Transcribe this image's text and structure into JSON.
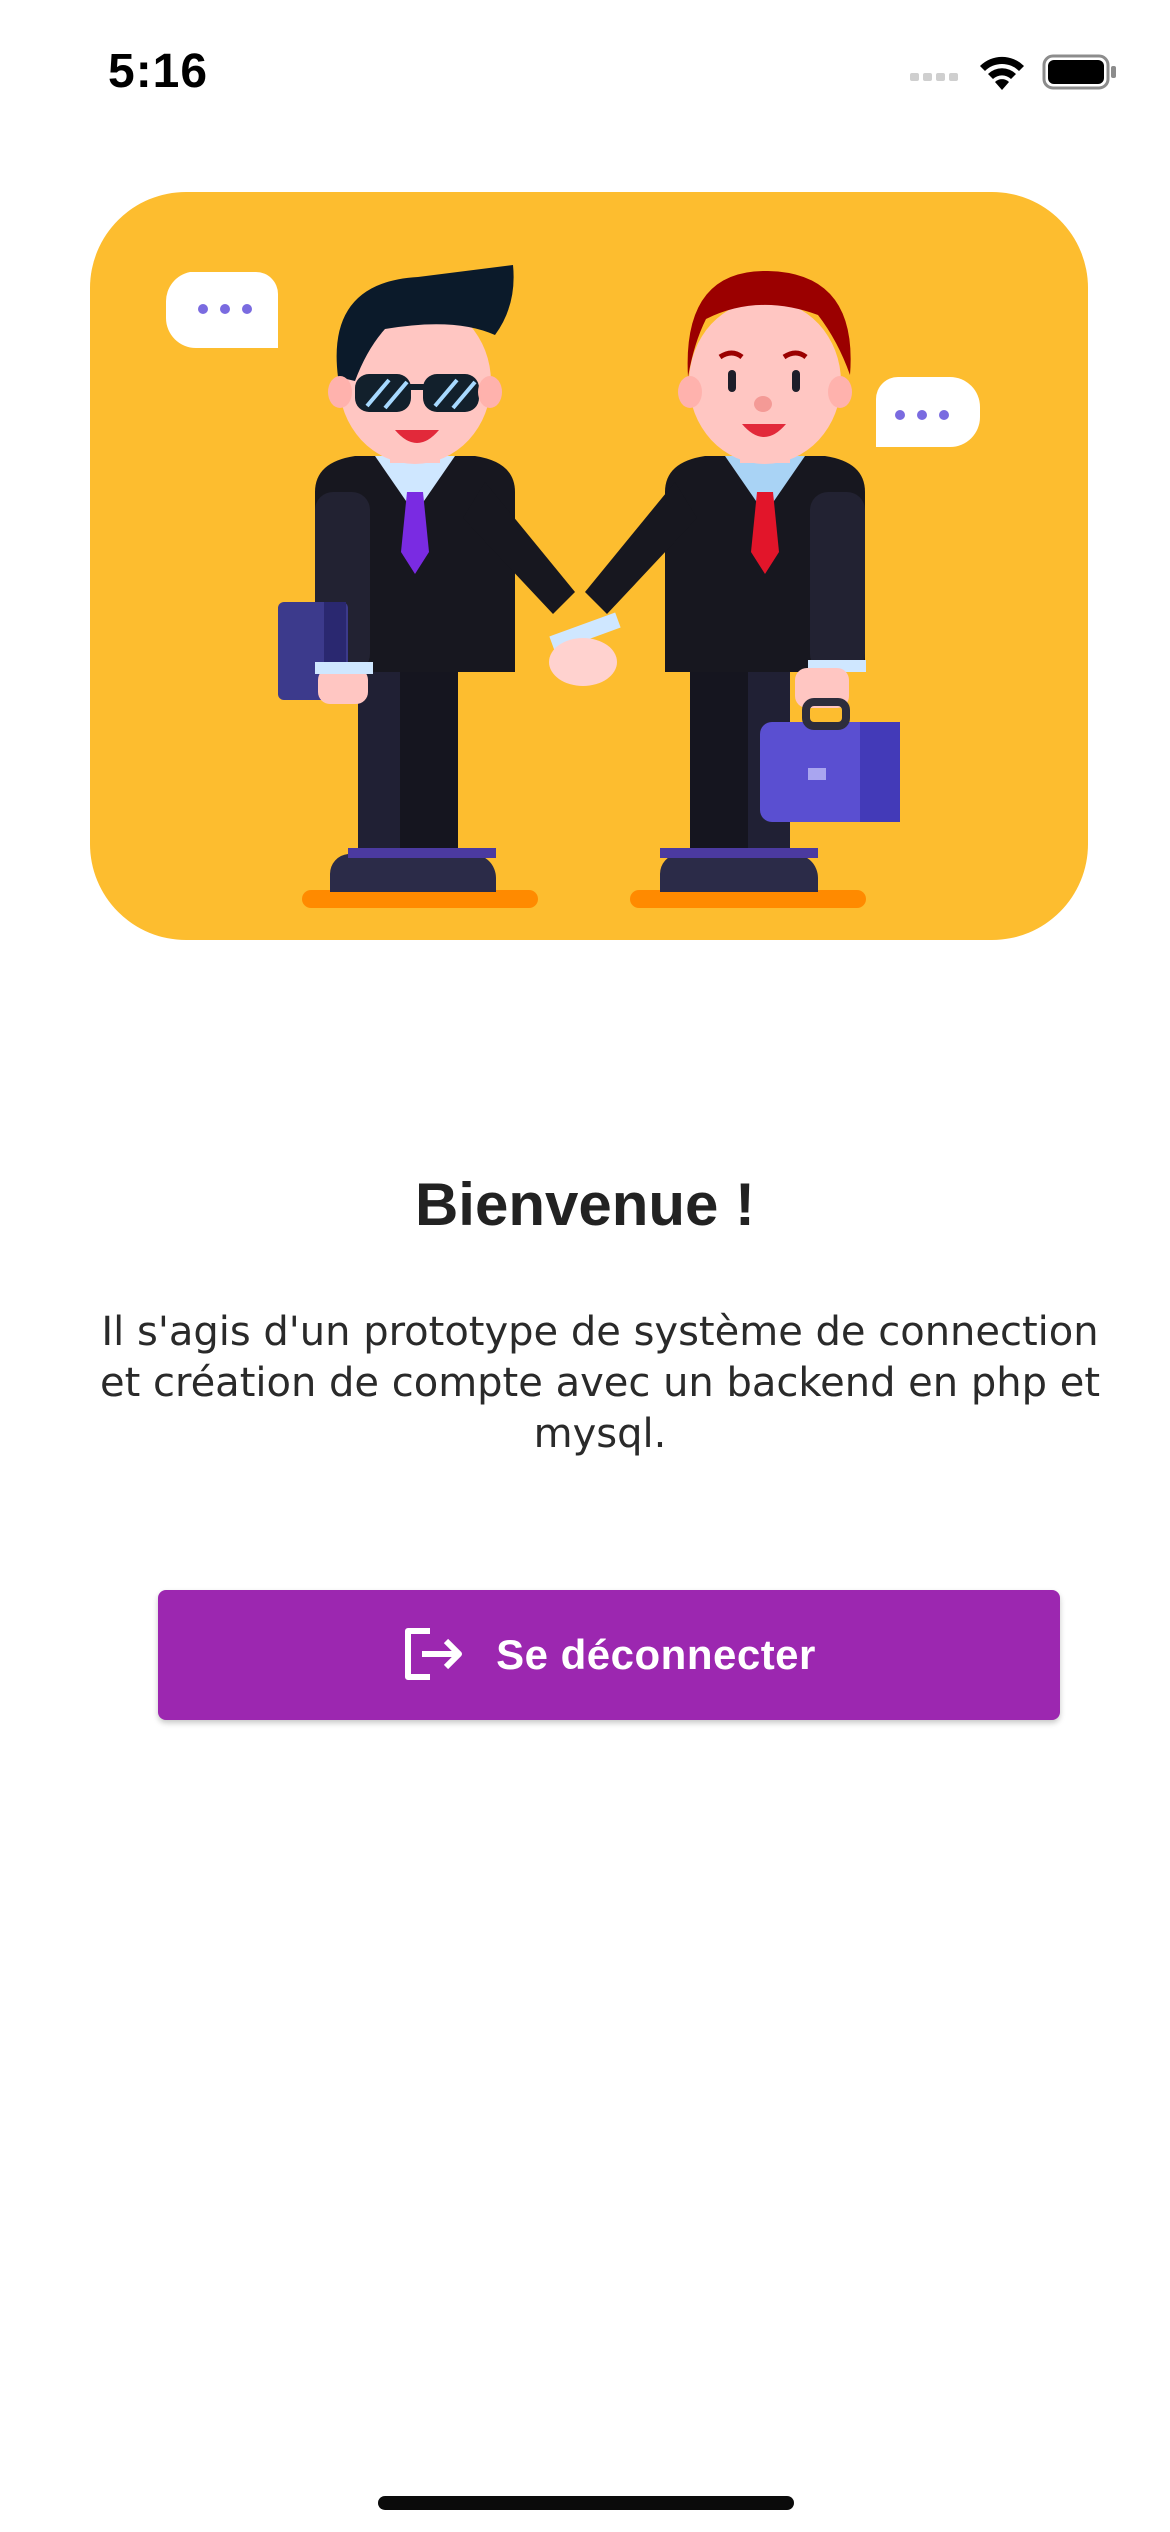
{
  "status_bar": {
    "time": "5:16",
    "icons": [
      "cellular-signal-icon",
      "wifi-icon",
      "battery-icon"
    ]
  },
  "hero": {
    "illustration": "two-businessmen-handshake-illustration",
    "background_color": "#fdbd2f"
  },
  "welcome": {
    "title": "Bienvenue !",
    "description": "Il s'agis d'un prototype de système de connection et création de compte avec un backend en php et mysql."
  },
  "logout_button": {
    "label": "Se déconnecter",
    "icon": "logout-icon",
    "color": "#9c27b0"
  }
}
